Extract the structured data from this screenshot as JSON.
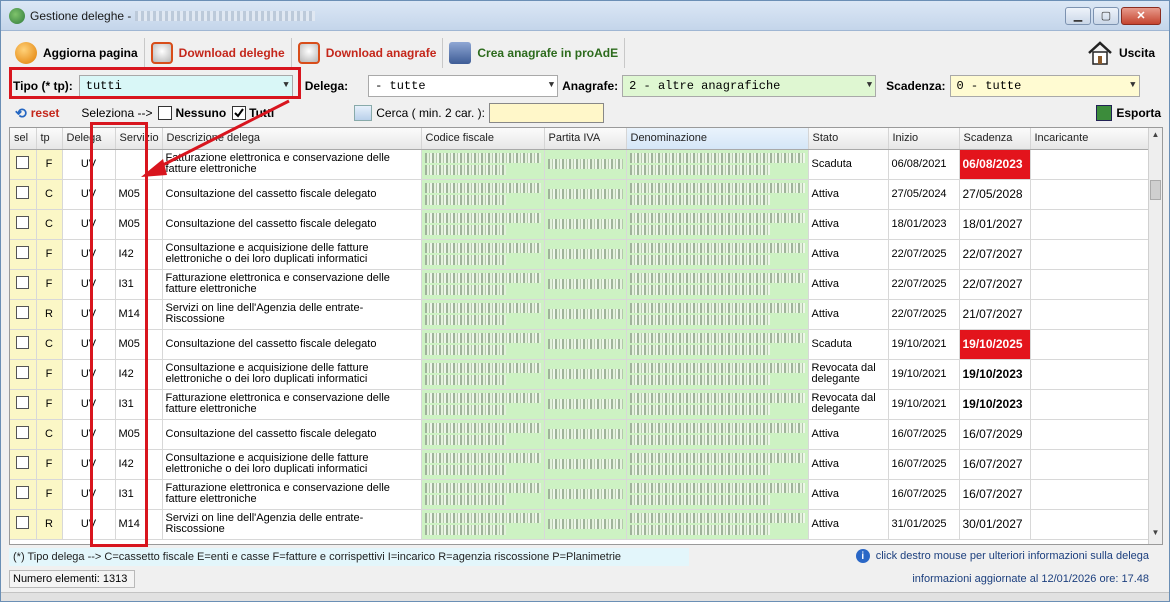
{
  "window": {
    "title": "Gestione deleghe - "
  },
  "toolbar": {
    "refresh": "Aggiorna pagina",
    "download_deleghe": "Download deleghe",
    "download_anagrafe": "Download anagrafe",
    "crea_anagrafe": "Crea anagrafe in proAdE",
    "exit": "Uscita"
  },
  "filters": {
    "tipo_label": "Tipo (* tp):",
    "tipo_value": "tutti",
    "delega_label": "Delega:",
    "delega_value": "- tutte",
    "anagrafe_label": "Anagrafe:",
    "anagrafe_value": "2 - altre anagrafiche",
    "scadenza_label": "Scadenza:",
    "scadenza_value": "0 - tutte"
  },
  "actions": {
    "reset": "reset",
    "select_label": "Seleziona -->",
    "none_label": "Nessuno",
    "all_label": "Tutti",
    "search_label": "Cerca ( min. 2 car. ):",
    "export": "Esporta"
  },
  "columns": [
    "sel",
    "tp",
    "Delega",
    "Servizio",
    "Descrizione delega",
    "Codice fiscale",
    "Partita IVA",
    "Denominazione",
    "Stato",
    "Inizio",
    "Scadenza",
    "Incaricante"
  ],
  "rows": [
    {
      "tp": "F",
      "delega": "UV",
      "servizio": "",
      "descrizione": "Fatturazione elettronica e conservazione delle fatture elettroniche",
      "stato": "Scaduta",
      "inizio": "06/08/2021",
      "scadenza": "06/08/2023",
      "scad_style": "expired"
    },
    {
      "tp": "C",
      "delega": "UV",
      "servizio": "M05",
      "descrizione": "Consultazione del cassetto fiscale delegato",
      "stato": "Attiva",
      "inizio": "27/05/2024",
      "scadenza": "27/05/2028",
      "scad_style": ""
    },
    {
      "tp": "C",
      "delega": "UV",
      "servizio": "M05",
      "descrizione": "Consultazione del cassetto fiscale delegato",
      "stato": "Attiva",
      "inizio": "18/01/2023",
      "scadenza": "18/01/2027",
      "scad_style": ""
    },
    {
      "tp": "F",
      "delega": "UV",
      "servizio": "I42",
      "descrizione": "Consultazione e acquisizione delle fatture elettroniche o dei loro duplicati informatici",
      "stato": "Attiva",
      "inizio": "22/07/2025",
      "scadenza": "22/07/2027",
      "scad_style": ""
    },
    {
      "tp": "F",
      "delega": "UV",
      "servizio": "I31",
      "descrizione": "Fatturazione elettronica e conservazione delle fatture elettroniche",
      "stato": "Attiva",
      "inizio": "22/07/2025",
      "scadenza": "22/07/2027",
      "scad_style": ""
    },
    {
      "tp": "R",
      "delega": "UV",
      "servizio": "M14",
      "descrizione": "Servizi on line dell'Agenzia delle entrate-Riscossione",
      "stato": "Attiva",
      "inizio": "22/07/2025",
      "scadenza": "21/07/2027",
      "scad_style": ""
    },
    {
      "tp": "C",
      "delega": "UV",
      "servizio": "M05",
      "descrizione": "Consultazione del cassetto fiscale delegato",
      "stato": "Scaduta",
      "inizio": "19/10/2021",
      "scadenza": "19/10/2025",
      "scad_style": "expired"
    },
    {
      "tp": "F",
      "delega": "UV",
      "servizio": "I42",
      "descrizione": "Consultazione e acquisizione delle fatture elettroniche o dei loro duplicati informatici",
      "stato": "Revocata dal delegante",
      "inizio": "19/10/2021",
      "scadenza": "19/10/2023",
      "scad_style": "bold"
    },
    {
      "tp": "F",
      "delega": "UV",
      "servizio": "I31",
      "descrizione": "Fatturazione elettronica e conservazione delle fatture elettroniche",
      "stato": "Revocata dal delegante",
      "inizio": "19/10/2021",
      "scadenza": "19/10/2023",
      "scad_style": "bold"
    },
    {
      "tp": "C",
      "delega": "UV",
      "servizio": "M05",
      "descrizione": "Consultazione del cassetto fiscale delegato",
      "stato": "Attiva",
      "inizio": "16/07/2025",
      "scadenza": "16/07/2029",
      "scad_style": ""
    },
    {
      "tp": "F",
      "delega": "UV",
      "servizio": "I42",
      "descrizione": "Consultazione e acquisizione delle fatture elettroniche o dei loro duplicati informatici",
      "stato": "Attiva",
      "inizio": "16/07/2025",
      "scadenza": "16/07/2027",
      "scad_style": ""
    },
    {
      "tp": "F",
      "delega": "UV",
      "servizio": "I31",
      "descrizione": "Fatturazione elettronica e conservazione delle fatture elettroniche",
      "stato": "Attiva",
      "inizio": "16/07/2025",
      "scadenza": "16/07/2027",
      "scad_style": ""
    },
    {
      "tp": "R",
      "delega": "UV",
      "servizio": "M14",
      "descrizione": "Servizi on line dell'Agenzia delle entrate-Riscossione",
      "stato": "Attiva",
      "inizio": "31/01/2025",
      "scadenza": "30/01/2027",
      "scad_style": ""
    }
  ],
  "footer": {
    "legend": "(*) Tipo delega -->   C=cassetto fiscale  E=enti e casse  F=fatture e corrispettivi  I=incarico  R=agenzia riscossione  P=Planimetrie",
    "info": "click destro mouse per ulteriori informazioni sulla delega",
    "count": "Numero elementi: 1313",
    "updated": "informazioni aggiornate al 12/01/2026  ore: 17.48"
  },
  "colors": {
    "expired": "#e3141c",
    "highlight_box": "#d8151e",
    "green_cells": "#cdf2c3",
    "yellow_cells": "#fbf7c6"
  }
}
